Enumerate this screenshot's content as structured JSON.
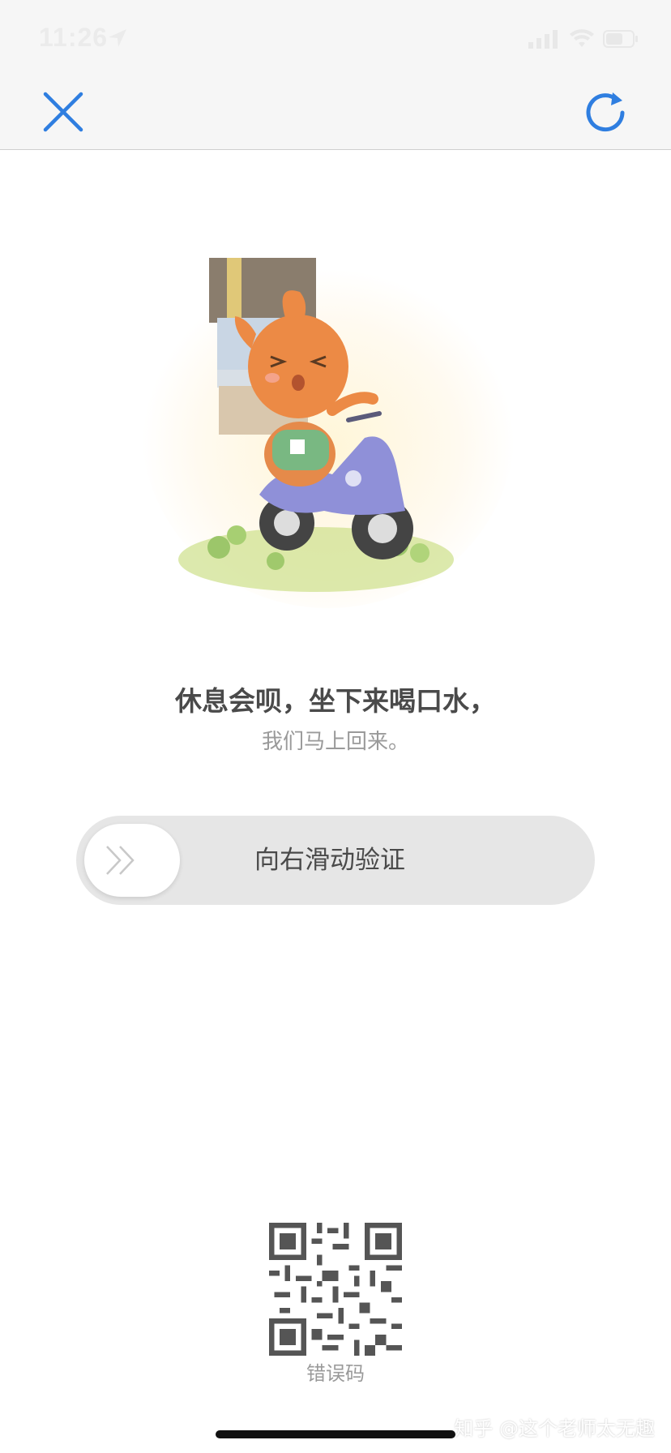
{
  "status_bar": {
    "time": "11:26",
    "icons": [
      "location-arrow-icon",
      "cellular-signal-icon",
      "wifi-icon",
      "battery-icon"
    ]
  },
  "nav": {
    "close_icon": "close-icon",
    "refresh_icon": "refresh-icon",
    "accent_color": "#2f7ee0"
  },
  "illustration": "delivery-character-on-scooter",
  "message": {
    "title": "休息会呗，坐下来喝口水，",
    "subtitle": "我们马上回来。"
  },
  "slider": {
    "label": "向右滑动验证",
    "handle_icon": "double-chevron-right-icon",
    "progress": 0
  },
  "qr": {
    "label": "错误码"
  },
  "watermark": "知乎 @这个老师太无趣"
}
